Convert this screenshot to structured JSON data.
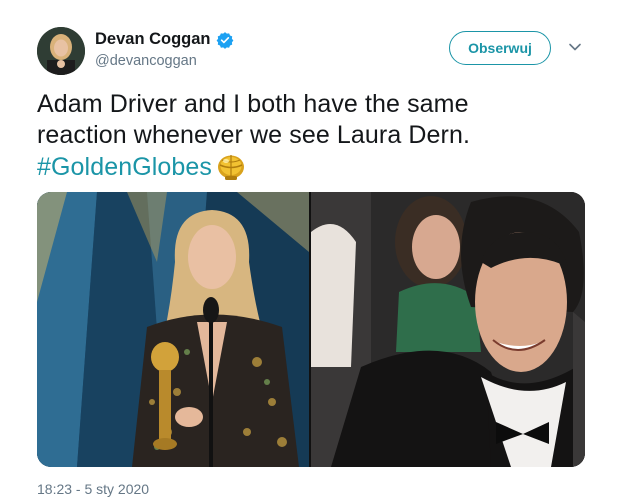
{
  "author": {
    "display_name": "Devan Coggan",
    "handle": "@devancoggan",
    "verified_badge_icon": "verified-check-icon",
    "badge_color": "#1da1f2"
  },
  "actions": {
    "follow_label": "Obserwuj",
    "menu_icon": "chevron-down-icon"
  },
  "tweet": {
    "text_line1": "Adam Driver and I both have the same",
    "text_line2": "reaction whenever we see Laura Dern.",
    "hashtag": "#GoldenGlobes",
    "hashflag_icon": "golden-globe-icon",
    "hashtag_color": "#1b95a7"
  },
  "media": {
    "photos": [
      {
        "icon": "photo-woman-holding-award"
      },
      {
        "icon": "photo-man-smiling-audience"
      }
    ]
  },
  "footer": {
    "timestamp": "18:23 - 5 sty 2020"
  }
}
